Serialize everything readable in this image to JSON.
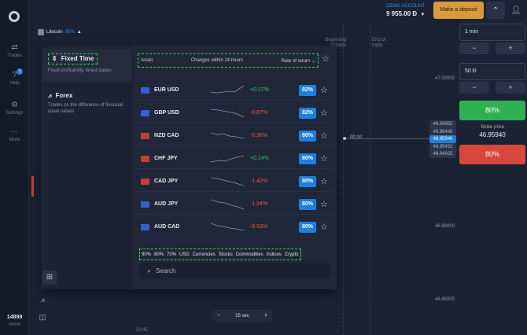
{
  "header": {
    "account_label": "DEMO ACCOUNT",
    "balance": "9 955.00 Đ",
    "deposit_button": "Make a deposit"
  },
  "rail": {
    "items": [
      {
        "label": "Trades",
        "icon": "arrows-icon"
      },
      {
        "label": "Help",
        "icon": "help-icon",
        "badge": "1"
      },
      {
        "label": "Settings",
        "icon": "gear-icon"
      },
      {
        "label": "More",
        "icon": "dots-icon"
      }
    ],
    "online_count": "14899",
    "online_label": "online"
  },
  "asset_selector": {
    "name": "Litecoin",
    "payout": "80%"
  },
  "chart": {
    "beginning_label": "Beginning of trade",
    "end_label": "End of trade",
    "timer": "00:10",
    "time_label": "20:45",
    "price_levels": [
      "47.00000",
      "46.90000",
      "46.85000"
    ],
    "price_tags": [
      "46.96955",
      "46.96448",
      "46.95940",
      "46.95432",
      "46.94925"
    ],
    "interval_value": "15 sec"
  },
  "right_panel": {
    "duration": "1 min",
    "amount": "50 Đ",
    "up_payout": "80%",
    "strike_label": "Strike price",
    "strike_value": "46.95940",
    "down_payout": "80%"
  },
  "popup": {
    "categories": [
      {
        "title": "Fixed Time",
        "desc": "Fixed profitability, timed trades"
      },
      {
        "title": "Forex",
        "desc": "Trades on the difference of financial asset values"
      }
    ],
    "columns": {
      "asset": "Asset",
      "change": "Changes within 24 hours",
      "rate": "Rate of return"
    },
    "assets": [
      {
        "name": "EUR USD",
        "change": "+0.27%",
        "dir": "up",
        "rate": "82%"
      },
      {
        "name": "GBP USD",
        "change": "-0.87%",
        "dir": "down",
        "rate": "82%"
      },
      {
        "name": "NZD CAD",
        "change": "-0.36%",
        "dir": "down",
        "rate": "80%"
      },
      {
        "name": "CHF JPY",
        "change": "+0.14%",
        "dir": "up",
        "rate": "80%"
      },
      {
        "name": "CAD JPY",
        "change": "-1.42%",
        "dir": "down",
        "rate": "80%"
      },
      {
        "name": "AUD JPY",
        "change": "-1.94%",
        "dir": "down",
        "rate": "80%"
      },
      {
        "name": "AUD CAD",
        "change": "-0.53%",
        "dir": "down",
        "rate": "80%"
      }
    ],
    "filters": [
      "90%",
      "80%",
      "70%",
      "USD",
      "Currencies",
      "Stocks",
      "Commodities",
      "Indices",
      "Crypto"
    ],
    "search_placeholder": "Search"
  },
  "colors": {
    "up": "#2fc564",
    "down": "#d9463a",
    "accent": "#1e7fe0",
    "deposit": "#d99a3e"
  }
}
